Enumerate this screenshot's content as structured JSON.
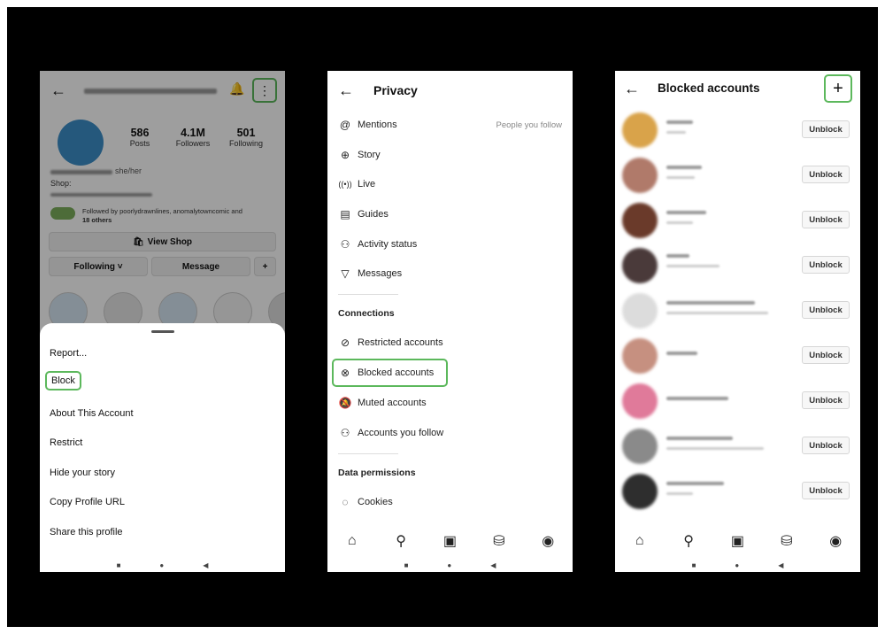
{
  "screen1": {
    "stats": [
      {
        "num": "586",
        "label": "Posts"
      },
      {
        "num": "4.1M",
        "label": "Followers"
      },
      {
        "num": "501",
        "label": "Following"
      }
    ],
    "pronouns": "she/her",
    "bio_line": "Shop:",
    "followed_by": "Followed by poorlydrawnlines, anomalytowncomic and",
    "followed_others": "18 others",
    "view_shop": "View Shop",
    "following_btn": "Following ˅",
    "message_btn": "Message",
    "sheet_items": [
      "Report...",
      "Block",
      "About This Account",
      "Restrict",
      "Hide your story",
      "Copy Profile URL",
      "Share this profile"
    ]
  },
  "screen2": {
    "title": "Privacy",
    "mentions_value": "People you follow",
    "top_items": [
      {
        "label": "Mentions",
        "icon": "at-icon"
      },
      {
        "label": "Story",
        "icon": "story-icon"
      },
      {
        "label": "Live",
        "icon": "live-icon"
      },
      {
        "label": "Guides",
        "icon": "guides-icon"
      },
      {
        "label": "Activity status",
        "icon": "activity-icon"
      },
      {
        "label": "Messages",
        "icon": "messages-icon"
      }
    ],
    "connections_title": "Connections",
    "connection_items": [
      {
        "label": "Restricted accounts",
        "icon": "restricted-icon"
      },
      {
        "label": "Blocked accounts",
        "icon": "blocked-icon"
      },
      {
        "label": "Muted accounts",
        "icon": "muted-icon"
      },
      {
        "label": "Accounts you follow",
        "icon": "people-icon"
      }
    ],
    "data_title": "Data permissions",
    "cookies": "Cookies"
  },
  "screen3": {
    "title": "Blocked accounts",
    "unblock_label": "Unblock",
    "accent": "#5cb85c"
  },
  "nav_icons": [
    "home-icon",
    "search-icon",
    "reels-icon",
    "shop-icon",
    "profile-icon"
  ]
}
